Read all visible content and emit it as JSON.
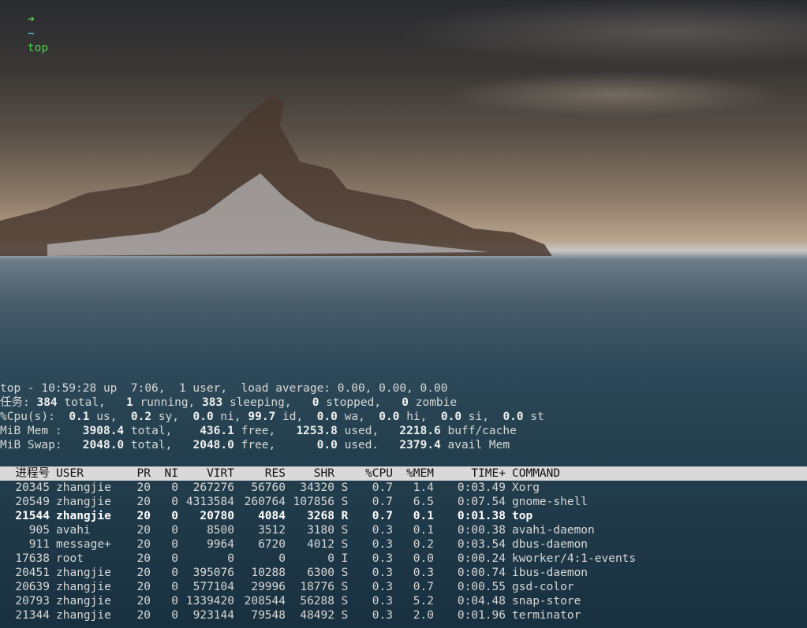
{
  "prompt": {
    "arrow": "➜",
    "dir": "~",
    "command": "top"
  },
  "summary": {
    "uptime_line": "top - 10:59:28 up  7:06,  1 user,  load average: 0.00, 0.00, 0.00",
    "tasks": {
      "label": "任务:",
      "total": "384",
      "total_label": " total,",
      "running": "1",
      "running_label": " running,",
      "sleeping": "383",
      "sleeping_label": " sleeping,",
      "stopped": "0",
      "stopped_label": " stopped,",
      "zombie": "0",
      "zombie_label": " zombie"
    },
    "cpu": {
      "label": "%Cpu(s):",
      "us": "0.1",
      "sy": "0.2",
      "ni": "0.0",
      "id": "99.7",
      "wa": "0.0",
      "hi": "0.0",
      "si": "0.0",
      "st": "0.0"
    },
    "mem": {
      "label": "MiB Mem :",
      "total": "3908.4",
      "free": "436.1",
      "used": "1253.8",
      "buff_cache": "2218.6"
    },
    "swap": {
      "label": "MiB Swap:",
      "total": "2048.0",
      "free": "2048.0",
      "used": "0.0",
      "avail": "2379.4"
    }
  },
  "columns": {
    "pid": "进程号",
    "user": "USER",
    "pr": "PR",
    "ni": "NI",
    "virt": "VIRT",
    "res": "RES",
    "shr": "SHR",
    "s": "",
    "cpu": "%CPU",
    "mem": "%MEM",
    "time": "TIME+",
    "command": "COMMAND"
  },
  "processes": [
    {
      "pid": "20345",
      "user": "zhangjie",
      "pr": "20",
      "ni": "0",
      "virt": "267276",
      "res": "56760",
      "shr": "34320",
      "s": "S",
      "cpu": "0.7",
      "mem": "1.4",
      "time": "0:03.49",
      "command": "Xorg"
    },
    {
      "pid": "20549",
      "user": "zhangjie",
      "pr": "20",
      "ni": "0",
      "virt": "4313584",
      "res": "260764",
      "shr": "107856",
      "s": "S",
      "cpu": "0.7",
      "mem": "6.5",
      "time": "0:07.54",
      "command": "gnome-shell"
    },
    {
      "pid": "21544",
      "user": "zhangjie",
      "pr": "20",
      "ni": "0",
      "virt": "20780",
      "res": "4084",
      "shr": "3268",
      "s": "R",
      "cpu": "0.7",
      "mem": "0.1",
      "time": "0:01.38",
      "command": "top"
    },
    {
      "pid": "905",
      "user": "avahi",
      "pr": "20",
      "ni": "0",
      "virt": "8500",
      "res": "3512",
      "shr": "3180",
      "s": "S",
      "cpu": "0.3",
      "mem": "0.1",
      "time": "0:00.38",
      "command": "avahi-daemon"
    },
    {
      "pid": "911",
      "user": "message+",
      "pr": "20",
      "ni": "0",
      "virt": "9964",
      "res": "6720",
      "shr": "4012",
      "s": "S",
      "cpu": "0.3",
      "mem": "0.2",
      "time": "0:03.54",
      "command": "dbus-daemon"
    },
    {
      "pid": "17638",
      "user": "root",
      "pr": "20",
      "ni": "0",
      "virt": "0",
      "res": "0",
      "shr": "0",
      "s": "I",
      "cpu": "0.3",
      "mem": "0.0",
      "time": "0:00.24",
      "command": "kworker/4:1-events"
    },
    {
      "pid": "20451",
      "user": "zhangjie",
      "pr": "20",
      "ni": "0",
      "virt": "395076",
      "res": "10288",
      "shr": "6300",
      "s": "S",
      "cpu": "0.3",
      "mem": "0.3",
      "time": "0:00.74",
      "command": "ibus-daemon"
    },
    {
      "pid": "20639",
      "user": "zhangjie",
      "pr": "20",
      "ni": "0",
      "virt": "577104",
      "res": "29996",
      "shr": "18776",
      "s": "S",
      "cpu": "0.3",
      "mem": "0.7",
      "time": "0:00.55",
      "command": "gsd-color"
    },
    {
      "pid": "20793",
      "user": "zhangjie",
      "pr": "20",
      "ni": "0",
      "virt": "1339420",
      "res": "208544",
      "shr": "56288",
      "s": "S",
      "cpu": "0.3",
      "mem": "5.2",
      "time": "0:04.48",
      "command": "snap-store"
    },
    {
      "pid": "21344",
      "user": "zhangjie",
      "pr": "20",
      "ni": "0",
      "virt": "923144",
      "res": "79548",
      "shr": "48492",
      "s": "S",
      "cpu": "0.3",
      "mem": "2.0",
      "time": "0:01.96",
      "command": "terminator"
    }
  ],
  "active_process_pid": "21544",
  "colors": {
    "prompt_arrow": "#4fd14f",
    "prompt_dir": "#4fc0c8",
    "header_bg": "#d9d9d9",
    "text": "#d8d8d8"
  }
}
